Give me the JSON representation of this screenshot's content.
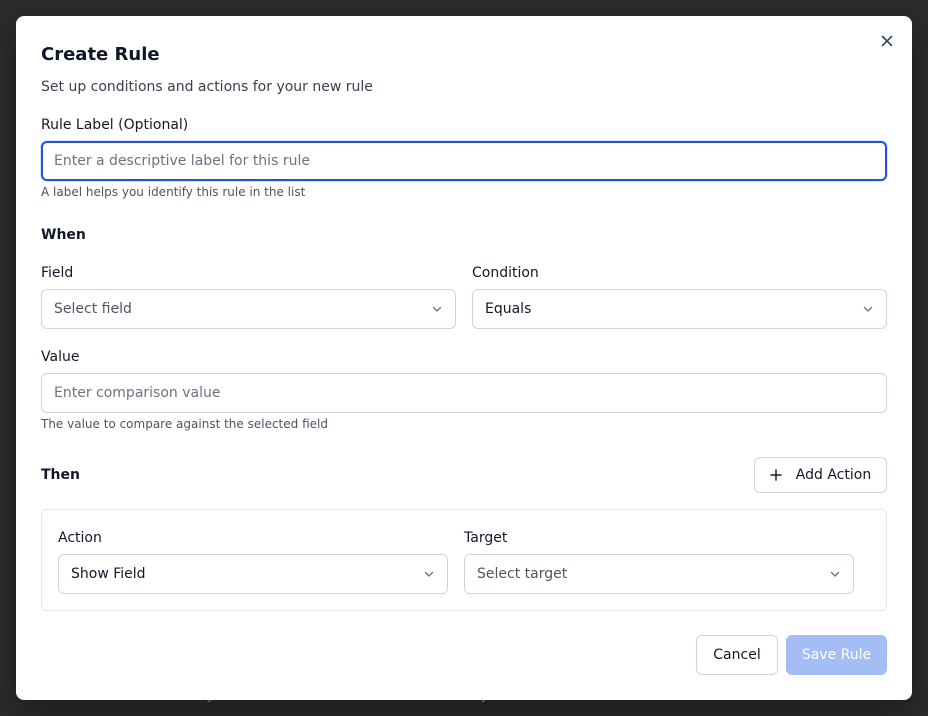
{
  "backdrop": {
    "text": "Hide this form from your active list. You can restore it at any time."
  },
  "dialog": {
    "title": "Create Rule",
    "subtitle": "Set up conditions and actions for your new rule",
    "close_icon": "close-icon"
  },
  "rule_label": {
    "label": "Rule Label (Optional)",
    "value": "",
    "placeholder": "Enter a descriptive label for this rule",
    "help": "A label helps you identify this rule in the list"
  },
  "when": {
    "heading": "When",
    "field": {
      "label": "Field",
      "value": "",
      "placeholder": "Select field"
    },
    "condition": {
      "label": "Condition",
      "value": "Equals"
    },
    "value": {
      "label": "Value",
      "value": "",
      "placeholder": "Enter comparison value",
      "help": "The value to compare against the selected field"
    }
  },
  "then": {
    "heading": "Then",
    "add_action_label": "Add Action",
    "actions": [
      {
        "action_label": "Action",
        "action_value": "Show Field",
        "target_label": "Target",
        "target_value": "",
        "target_placeholder": "Select target"
      }
    ]
  },
  "footer": {
    "cancel_label": "Cancel",
    "save_label": "Save Rule"
  },
  "colors": {
    "accent": "#2451d6",
    "primary_disabled": "#a5bdf5",
    "overlay": "#2b2b2b"
  }
}
